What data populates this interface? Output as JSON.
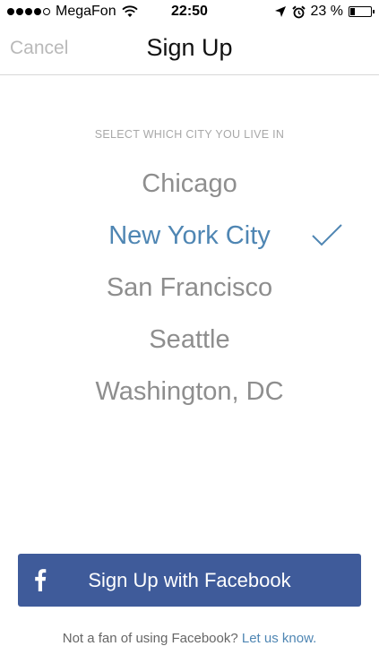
{
  "status_bar": {
    "signal_bars_filled": 4,
    "signal_bars_total": 5,
    "carrier": "MegaFon",
    "time": "22:50",
    "battery": "23 %",
    "battery_level": 0.23,
    "icons": [
      "wifi-icon",
      "location-arrow-icon",
      "alarm-icon",
      "battery-icon"
    ]
  },
  "nav": {
    "cancel_label": "Cancel",
    "title": "Sign Up"
  },
  "city_picker": {
    "header": "SELECT WHICH CITY YOU LIVE IN",
    "cities": [
      "Chicago",
      "New York City",
      "San Francisco",
      "Seattle",
      "Washington, DC"
    ],
    "selected": "New York City"
  },
  "facebook": {
    "button_label": "Sign Up with Facebook",
    "icon": "facebook-f-icon"
  },
  "footer": {
    "text": "Not a fan of using Facebook? ",
    "link_label": "Let us know."
  },
  "colors": {
    "accent": "#4f86b3",
    "facebook": "#3f5b9a",
    "city_text": "#8e8e8e",
    "cancel_text": "#b9b9b9"
  }
}
